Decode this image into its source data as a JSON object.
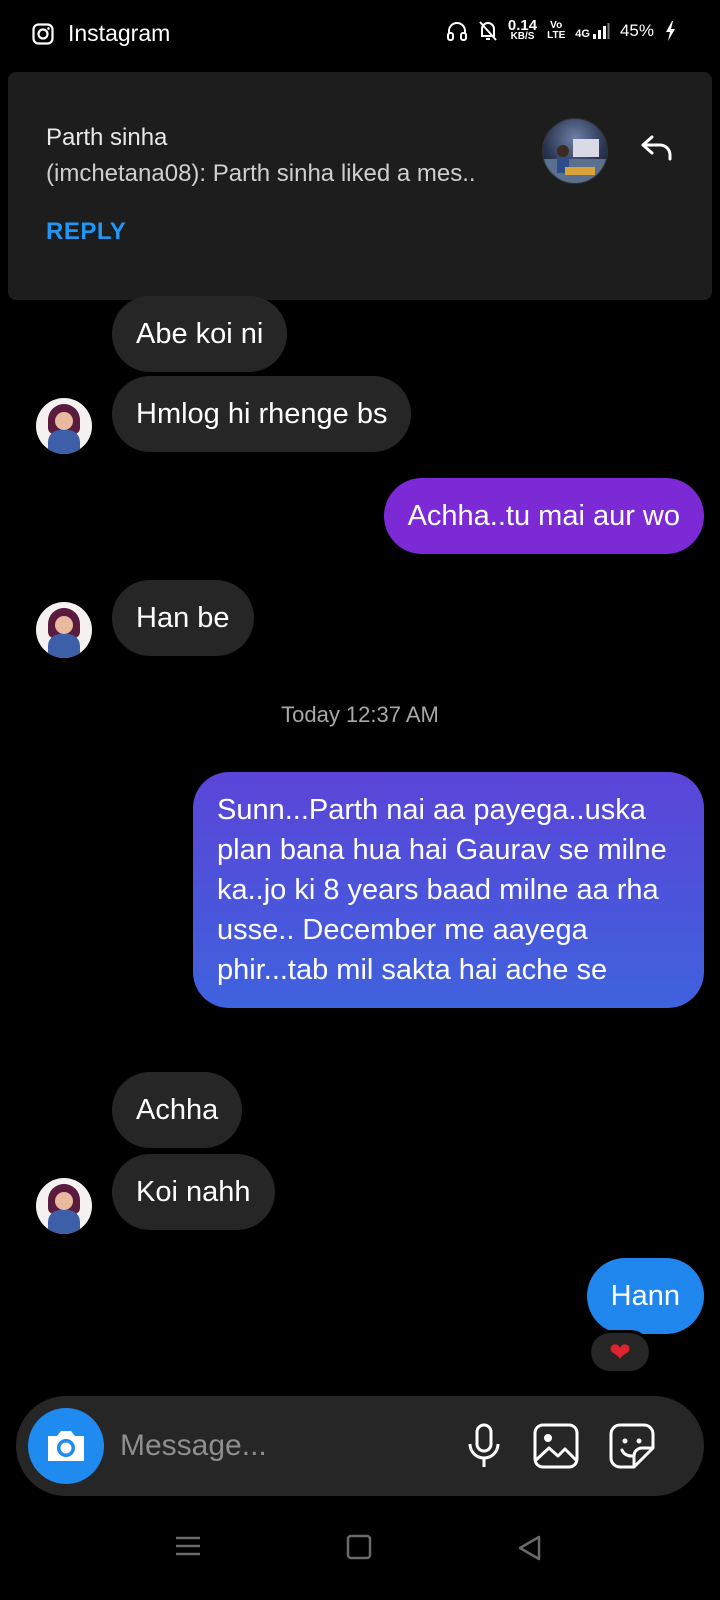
{
  "status_bar": {
    "app_name": "Instagram",
    "net_speed_value": "0.14",
    "net_speed_unit": "KB/S",
    "volte_top": "Vo",
    "volte_bottom": "LTE",
    "network": "4G",
    "battery": "45%"
  },
  "notification": {
    "sender": "Parth sinha",
    "text": "(imchetana08): Parth sinha liked a mes..",
    "reply_label": "REPLY"
  },
  "messages": [
    {
      "from": "them",
      "text": "Abe koi ni"
    },
    {
      "from": "them",
      "text": "Hmlog hi rhenge bs"
    },
    {
      "from": "me",
      "text": "Achha..tu mai aur wo"
    },
    {
      "from": "them",
      "text": "Han be"
    },
    {
      "from": "me",
      "text": "Sunn...Parth nai aa payega..uska plan bana hua hai Gaurav se milne ka..jo ki 8 years baad milne aa rha usse.. December me aayega phir...tab mil sakta hai ache se"
    },
    {
      "from": "them",
      "text": "Achha"
    },
    {
      "from": "them",
      "text": "Koi nahh"
    },
    {
      "from": "me",
      "text": "Hann"
    }
  ],
  "timestamp": "Today 12:37 AM",
  "reaction": "❤",
  "composer": {
    "placeholder": "Message..."
  },
  "colors": {
    "accent_blue": "#1f8af0",
    "bubble_purple": "#7b2ad6",
    "bubble_incoming": "#262626"
  }
}
